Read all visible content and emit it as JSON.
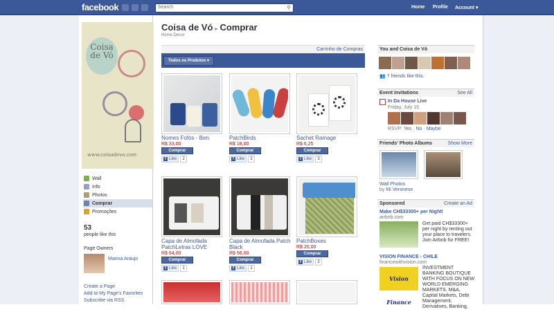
{
  "topbar": {
    "logo": "facebook",
    "search_placeholder": "Search",
    "nav": [
      "Home",
      "Profile",
      "Account ▾"
    ]
  },
  "left": {
    "banner_title": "Coisa de Vó",
    "banner_url": "www.coisadevo.com",
    "menu": [
      "Wall",
      "Info",
      "Photos",
      "Comprar",
      "Promoções"
    ],
    "likes_count": "53",
    "likes_label": "people like this",
    "owners_heading": "Page Owners",
    "owner_name": "Marina Araujo",
    "links": [
      "Create a Page",
      "Add to My Page's Favorites",
      "Subscribe via RSS"
    ]
  },
  "main": {
    "page_name": "Coisa de Vó",
    "section": "Comprar",
    "category": "Home Decor",
    "cart_label": "Carrinho de Compras",
    "filter_label": "Todos os Produtos ▾",
    "buy_label": "Comprar",
    "like_label": "Like",
    "products": [
      {
        "name": "Nomes Fofos - Ben",
        "price": "R$ 33,00",
        "likes": "2"
      },
      {
        "name": "PatchBirds",
        "price": "R$ 18,00",
        "likes": "2"
      },
      {
        "name": "Sachet Ramage",
        "price": "R$ 6,25",
        "likes": "3"
      },
      {
        "name": "Capa de Almofada PatchLetras LOVE",
        "price": "R$ 64,00",
        "likes": "1"
      },
      {
        "name": "Capa de Almofada Patch Black",
        "price": "R$ 56,00",
        "likes": "1"
      },
      {
        "name": "PatchBoxes",
        "price": "R$ 20,00",
        "likes": "2"
      }
    ]
  },
  "right": {
    "you_and_page": "You and Coisa de Vó",
    "friends_like": "7 friends like this.",
    "event_invitations": "Event Invitations",
    "see_all": "See All",
    "event_name": "In Da House Live",
    "event_date": "Friday, July 15",
    "rsvp_label": "RSVP:",
    "rsvp_options": [
      "Yes",
      "No",
      "Maybe"
    ],
    "friends_albums": "Friends' Photo Albums",
    "show_more": "Show More",
    "album_name": "Wall Photos",
    "album_by": "by",
    "album_owner": "Mi Veronese",
    "sponsored": "Sponsored",
    "create_ad": "Create an Ad",
    "ad1_title": "Make CH$33300+ per Night!",
    "ad1_domain": "airbnb.com",
    "ad1_text": "Get paid CH$33300+ per night by renting out your place to travelers. Join Airbnb for FREE!",
    "ad2_title": "VISION FINANCE - CHILE",
    "ad2_domain": "financewithvision.com",
    "ad2_logo": "Vision Finance",
    "ad2_text": "INVESTMENT BANKING BOUTIQUE WITH FOCUS ON NEW WORLD EMERGING MARKETS. M&A, Capital Markets, Debt Management, Derivatives, Banking,"
  }
}
